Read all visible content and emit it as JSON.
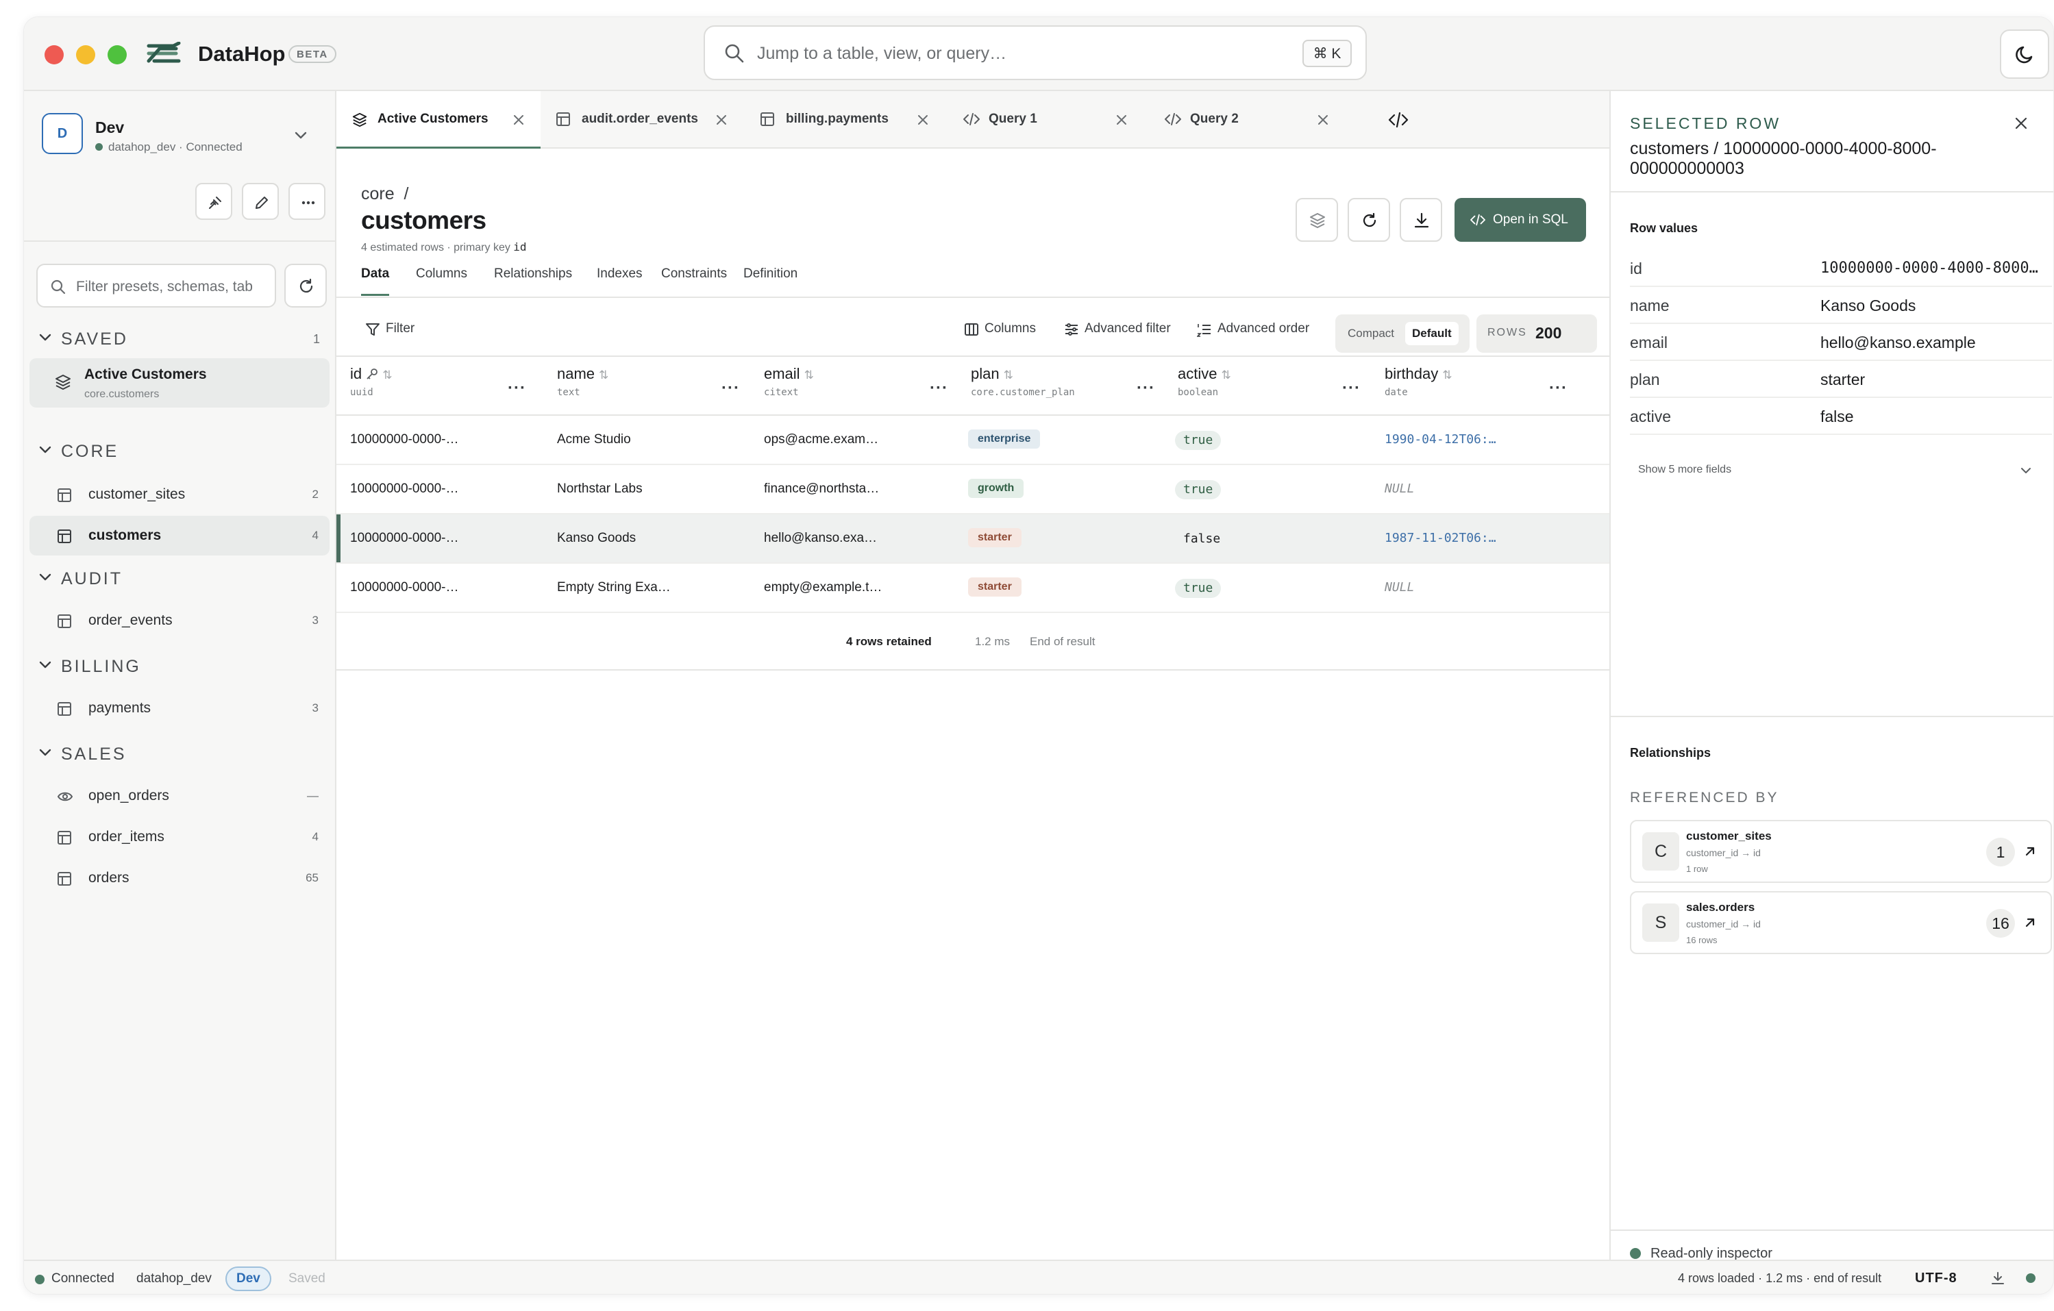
{
  "app": {
    "name": "DataHop",
    "badge": "BETA",
    "search_placeholder": "Jump to a table, view, or query…",
    "search_shortcut": "⌘ K",
    "accent": "#4a6d5f"
  },
  "connection": {
    "avatar": "D",
    "name": "Dev",
    "database": "datahop_dev",
    "status": "Connected"
  },
  "sidebar": {
    "filter_placeholder": "Filter presets, schemas, tab",
    "sections": {
      "saved": {
        "label": "SAVED",
        "count": "1"
      },
      "core": {
        "label": "CORE"
      },
      "audit": {
        "label": "AUDIT"
      },
      "billing": {
        "label": "BILLING"
      },
      "sales": {
        "label": "SALES"
      }
    },
    "saved_item": {
      "name": "Active Customers",
      "source": "core.customers"
    },
    "items": [
      {
        "label": "customer_sites",
        "count": "2",
        "icon": "table-icon"
      },
      {
        "label": "customers",
        "count": "4",
        "icon": "table-icon"
      },
      {
        "label": "order_events",
        "count": "3",
        "icon": "table-icon"
      },
      {
        "label": "payments",
        "count": "3",
        "icon": "table-icon"
      },
      {
        "label": "open_orders",
        "count": "—",
        "icon": "eye-icon"
      },
      {
        "label": "order_items",
        "count": "4",
        "icon": "table-icon"
      },
      {
        "label": "orders",
        "count": "65",
        "icon": "table-icon"
      }
    ]
  },
  "tabs": [
    {
      "label": "Active Customers",
      "icon": "layers-icon"
    },
    {
      "label": "audit.order_events",
      "icon": "table-icon"
    },
    {
      "label": "billing.payments",
      "icon": "table-icon"
    },
    {
      "label": "Query 1",
      "icon": "code-icon"
    },
    {
      "label": "Query 2",
      "icon": "code-icon"
    }
  ],
  "page": {
    "schema": "core",
    "separator": "/",
    "title": "customers",
    "meta_prefix": "4 estimated rows · primary key",
    "primary_key": "id",
    "open_sql": "Open in SQL"
  },
  "subtabs": [
    "Data",
    "Columns",
    "Relationships",
    "Indexes",
    "Constraints",
    "Definition"
  ],
  "toolbar": {
    "filter": "Filter",
    "columns": "Columns",
    "advanced_filter": "Advanced filter",
    "advanced_order": "Advanced order",
    "density_compact": "Compact",
    "density_default": "Default",
    "rows_label": "ROWS",
    "rows_value": "200"
  },
  "grid": {
    "columns": [
      {
        "name": "id",
        "type": "uuid"
      },
      {
        "name": "name",
        "type": "text"
      },
      {
        "name": "email",
        "type": "citext"
      },
      {
        "name": "plan",
        "type": "core.customer_plan"
      },
      {
        "name": "active",
        "type": "boolean"
      },
      {
        "name": "birthday",
        "type": "date"
      }
    ],
    "rows": [
      {
        "id": "10000000-0000-…",
        "name": "Acme Studio",
        "email": "ops@acme.exam…",
        "plan": "enterprise",
        "active": "true",
        "birthday": "1990-04-12T06:…"
      },
      {
        "id": "10000000-0000-…",
        "name": "Northstar Labs",
        "email": "finance@northsta…",
        "plan": "growth",
        "active": "true",
        "birthday": "NULL"
      },
      {
        "id": "10000000-0000-…",
        "name": "Kanso Goods",
        "email": "hello@kanso.exa…",
        "plan": "starter",
        "active": "false",
        "birthday": "1987-11-02T06:…"
      },
      {
        "id": "10000000-0000-…",
        "name": "Empty String Exa…",
        "email": "empty@example.t…",
        "plan": "starter",
        "active": "true",
        "birthday": "NULL"
      }
    ],
    "footer": {
      "retained": "4 rows retained",
      "time": "1.2 ms",
      "end": "End of result"
    }
  },
  "inspector": {
    "eyebrow": "SELECTED ROW",
    "title": "customers / 10000000-0000-4000-8000-000000000003",
    "row_values_label": "Row values",
    "fields": [
      {
        "key": "id",
        "value": "10000000-0000-4000-8000…"
      },
      {
        "key": "name",
        "value": "Kanso Goods"
      },
      {
        "key": "email",
        "value": "hello@kanso.example"
      },
      {
        "key": "plan",
        "value": "starter"
      },
      {
        "key": "active",
        "value": "false"
      }
    ],
    "more_fields": "Show 5 more fields",
    "relationships_label": "Relationships",
    "referenced_by_label": "REFERENCED BY",
    "references": [
      {
        "avatar": "C",
        "name": "customer_sites",
        "relation": "customer_id → id",
        "rows": "1 row",
        "count": "1"
      },
      {
        "avatar": "S",
        "name": "sales.orders",
        "relation": "customer_id → id",
        "rows": "16 rows",
        "count": "16"
      }
    ],
    "footer": "Read-only inspector"
  },
  "statusbar": {
    "status": "Connected",
    "database": "datahop_dev",
    "env": "Dev",
    "saved": "Saved",
    "summary": "4 rows loaded · 1.2 ms · end of result",
    "encoding": "UTF-8"
  }
}
